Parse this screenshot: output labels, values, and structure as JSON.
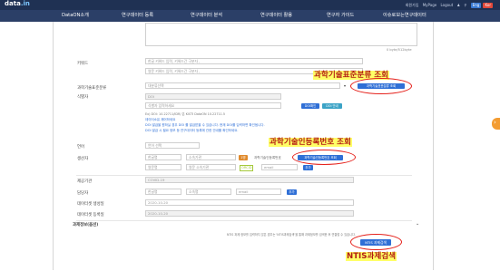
{
  "header": {
    "logo": "data",
    "logo_suffix": ".in",
    "util_links": [
      "회원가입",
      "MyPage",
      "Logout"
    ],
    "en_label": "Eng",
    "kr_label": "Kor"
  },
  "nav": {
    "items": [
      "DataON소개",
      "연구데이터 등록",
      "연구데이터 분석",
      "연구데이터 활용",
      "연구자 가이드",
      "이슈로보는연구데이터"
    ]
  },
  "form": {
    "char_count": "0 byte/512byte",
    "keyword": {
      "label": "키워드",
      "input1_placeholder": "한글 키워드 입력, 키워드간 구분자 ,",
      "input2_placeholder": "영문 키워드 입력, 키워드간 구분자 ,"
    },
    "classification": {
      "label": "과학기술표준분류",
      "select_value": "대분류선택",
      "button": "과학기술표준분류 조회"
    },
    "identifier": {
      "label": "식별자",
      "type_value": "DOI",
      "input_placeholder": "식별자 입력하세요",
      "check_button": "DOI확인",
      "guide_button": "DOI 안내",
      "example": "Ex) DOI: 10.22711/IDR/ 은 KISTI DataON 10.22711.5",
      "note1": "데이터소유 제어하세요",
      "note2": "DOI 발급을 원하실 경우 DOI 를 발급받을 수 있습니다. 현재 DOI를 입력하면 확인됩니다.",
      "note3": "DOI 발급 시 필요 정보 등 연구데이터 등록에 관한 안내를 확인하세요."
    },
    "language": {
      "label": "언어",
      "select_value": "언어 선택"
    },
    "creator": {
      "label": "생산자",
      "name_placeholder": "한글명",
      "affiliation_placeholder": "소속기관",
      "badge": "1명",
      "researcher_field": "과학기술인등록번호",
      "researcher_button": "과학기술인등록번호 조회",
      "en_name_placeholder": "영문명",
      "en_affiliation_placeholder": "영문 소속기관",
      "orcid": "ORCID",
      "email_placeholder": "email",
      "add_button": "추가"
    },
    "funder": {
      "label": "제공기관",
      "value": "COVID-19"
    },
    "contact": {
      "label": "담당자",
      "name_placeholder": "한글명",
      "affiliation_placeholder": "소속명",
      "email_placeholder": "email",
      "add_button": "추가"
    },
    "created_date": {
      "label": "데이터셋 생성일",
      "value": "2020-10-20"
    },
    "registered_date": {
      "label": "데이터셋 등록일",
      "value": "2020-10-20"
    },
    "project": {
      "label": "과제정보(옵션)",
      "description": "NTIS 과제 정보를 입력하지 않은 경우는 'NTIS과제검색'을 통해 과제정보를 검색한 후 연결할 수 있습니다.",
      "button": "NTIS 과제검색"
    }
  },
  "annotations": {
    "classification": "과학기술표준분류 조회",
    "researcher": "과학기술인등록번호 조회",
    "ntis": "NTIS과제검색"
  },
  "colors": {
    "topbar": "#1f3153",
    "navbar": "#2b3f67",
    "button_blue": "#2f6fd6",
    "annotation_red": "#e5201a",
    "highlight_yellow": "#ffff66"
  }
}
